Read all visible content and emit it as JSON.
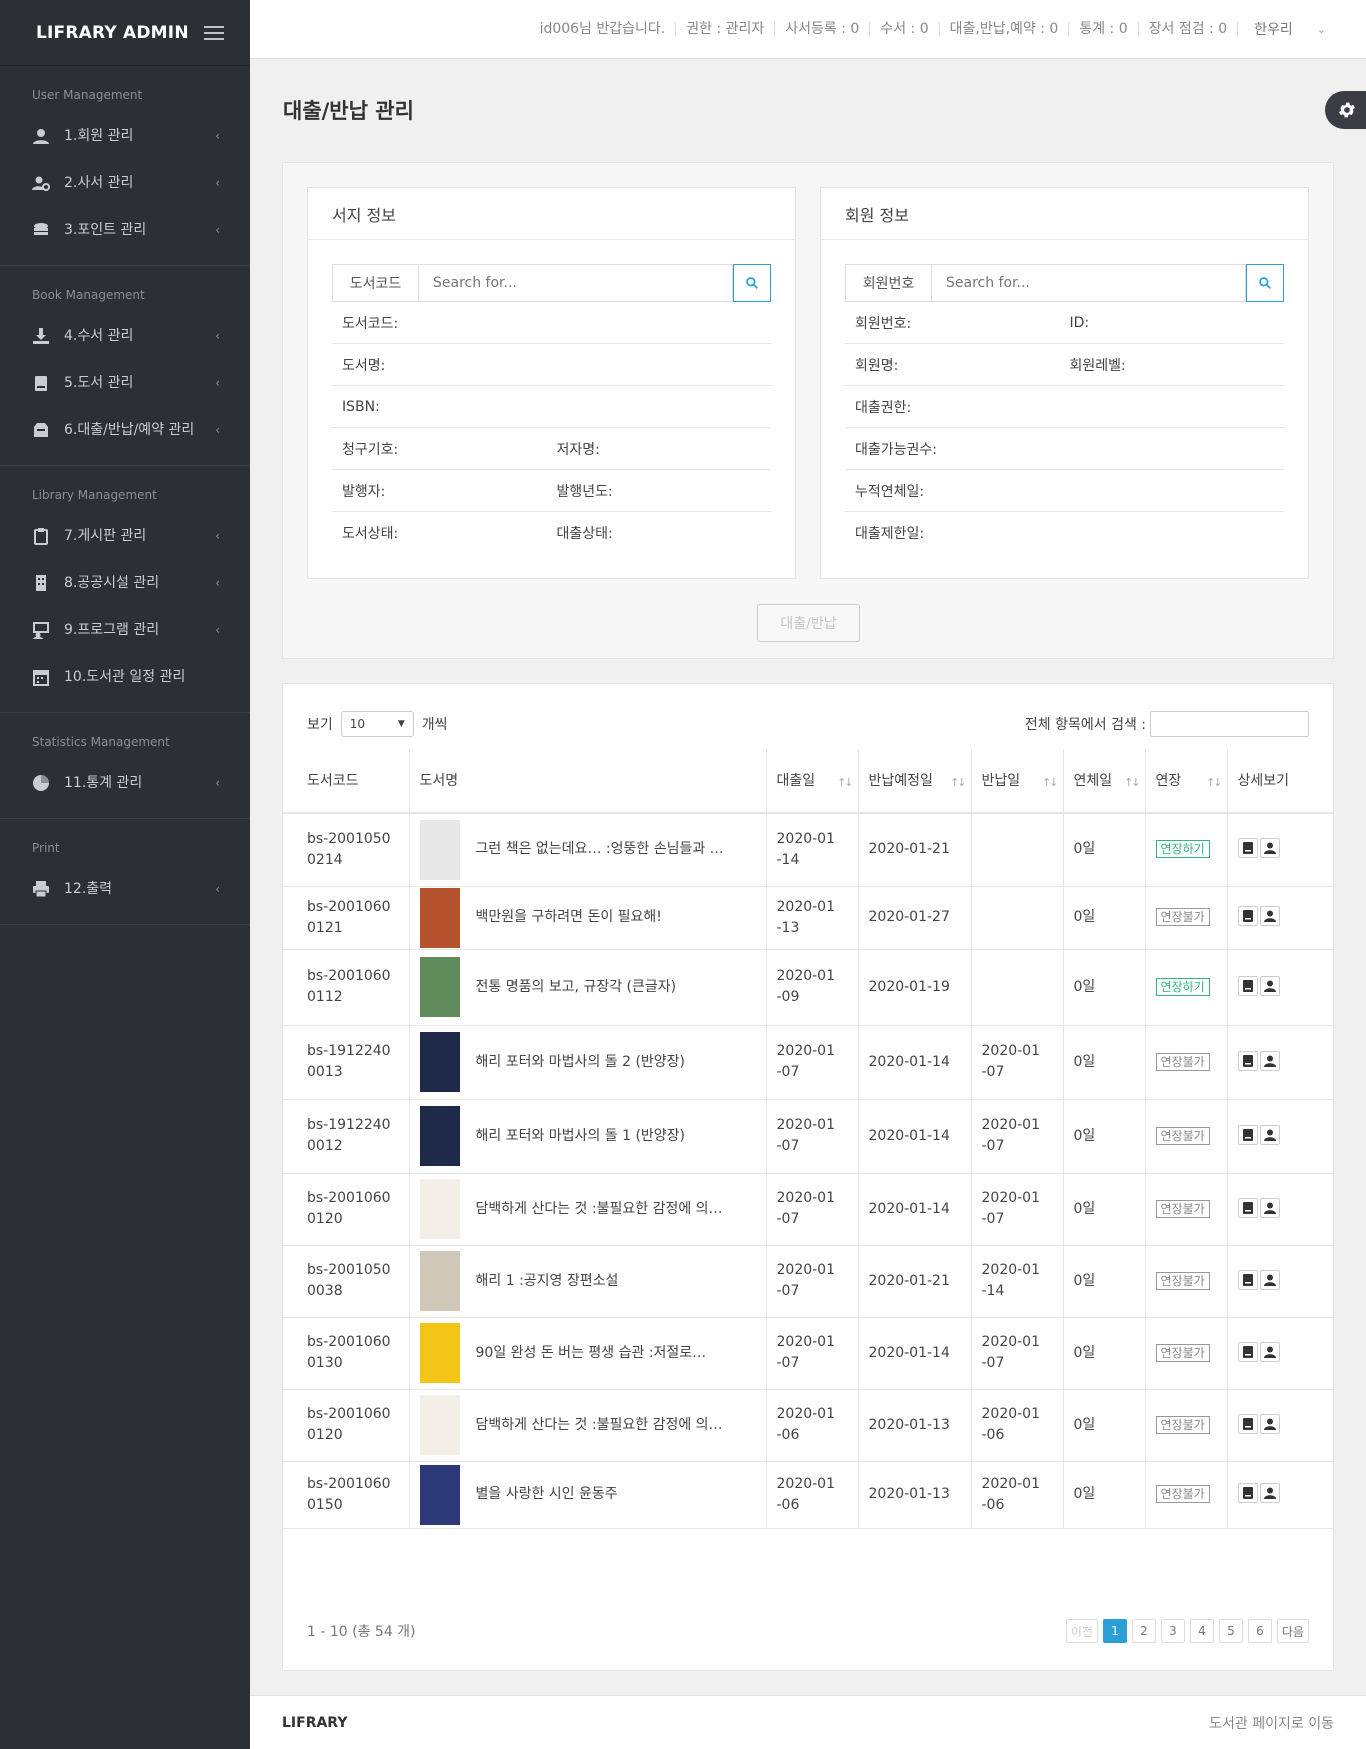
{
  "brand": {
    "title": "LIFRARY ADMIN"
  },
  "topbar": {
    "greeting": "id006님 반갑습니다.",
    "role": "권한 : 관리자",
    "items": [
      "사서등록 : 0",
      "수서 : 0",
      "대출,반납,예약 : 0",
      "통계 : 0",
      "장서 점검 : 0"
    ],
    "user": "한우리"
  },
  "sidebar": {
    "sections": [
      {
        "title": "User Management",
        "items": [
          "1.회원 관리",
          "2.사서 관리",
          "3.포인트 관리"
        ]
      },
      {
        "title": "Book Management",
        "items": [
          "4.수서 관리",
          "5.도서 관리",
          "6.대출/반납/예약 관리"
        ]
      },
      {
        "title": "Library Management",
        "items": [
          "7.게시판 관리",
          "8.공공시설 관리",
          "9.프로그램 관리",
          "10.도서관 일정 관리"
        ]
      },
      {
        "title": "Statistics Management",
        "items": [
          "11.통계 관리"
        ]
      },
      {
        "title": "Print",
        "items": [
          "12.출력"
        ]
      }
    ]
  },
  "page": {
    "title": "대출/반납 관리"
  },
  "book_card": {
    "title": "서지 정보",
    "search_label": "도서코드",
    "search_placeholder": "Search for...",
    "fields": {
      "code": "도서코드:",
      "name": "도서명:",
      "isbn": "ISBN:",
      "call_no": "청구기호:",
      "author": "저자명:",
      "publisher": "발행자:",
      "year": "발행년도:",
      "status": "도서상태:",
      "loan_status": "대출상태:"
    }
  },
  "member_card": {
    "title": "회원 정보",
    "search_label": "회원번호",
    "search_placeholder": "Search for...",
    "fields": {
      "no": "회원번호:",
      "id": "ID:",
      "name": "회원명:",
      "level": "회원레벨:",
      "right": "대출권한:",
      "avail": "대출가능권수:",
      "overdue": "누적연체일:",
      "limit": "대출제한일:"
    }
  },
  "lend_button": "대출/반납",
  "table": {
    "show_label": "보기",
    "page_size": "10",
    "unit_label": "개씩",
    "search_label": "전체 항목에서 검색 :",
    "headers": [
      "도서코드",
      "도서명",
      "대출일",
      "반납예정일",
      "반납일",
      "연체일",
      "연장",
      "상세보기"
    ],
    "rows": [
      {
        "code": "bs-20010500214",
        "title": "그런 책은 없는데요… :엉뚱한 손님들과 …",
        "loan": "2020-01-14",
        "due": "2020-01-21",
        "ret": "",
        "overdue": "0일",
        "ext": "연장하기",
        "ext_ok": true,
        "cover": "#e8e8e8"
      },
      {
        "code": "bs-20010600121",
        "title": "백만원을 구하려면 돈이 필요해!",
        "loan": "2020-01-13",
        "due": "2020-01-27",
        "ret": "",
        "overdue": "0일",
        "ext": "연장불가",
        "ext_ok": false,
        "cover": "#b5532e"
      },
      {
        "code": "bs-20010600112",
        "title": "전통 명품의 보고, 규장각 (큰글자)",
        "loan": "2020-01-09",
        "due": "2020-01-19",
        "ret": "",
        "overdue": "0일",
        "ext": "연장하기",
        "ext_ok": true,
        "cover": "#5f8a5a"
      },
      {
        "code": "bs-19122400013",
        "title": "해리 포터와 마법사의 돌 2 (반양장)",
        "loan": "2020-01-07",
        "due": "2020-01-14",
        "ret": "2020-01-07",
        "overdue": "0일",
        "ext": "연장불가",
        "ext_ok": false,
        "cover": "#1f2a4a"
      },
      {
        "code": "bs-19122400012",
        "title": "해리 포터와 마법사의 돌 1 (반양장)",
        "loan": "2020-01-07",
        "due": "2020-01-14",
        "ret": "2020-01-07",
        "overdue": "0일",
        "ext": "연장불가",
        "ext_ok": false,
        "cover": "#1f2a4a"
      },
      {
        "code": "bs-20010600120",
        "title": "담백하게 산다는 것 :불필요한 감정에 의…",
        "loan": "2020-01-07",
        "due": "2020-01-14",
        "ret": "2020-01-07",
        "overdue": "0일",
        "ext": "연장불가",
        "ext_ok": false,
        "cover": "#f3efe6"
      },
      {
        "code": "bs-20010500038",
        "title": "해리 1 :공지영 장편소설",
        "loan": "2020-01-07",
        "due": "2020-01-21",
        "ret": "2020-01-14",
        "overdue": "0일",
        "ext": "연장불가",
        "ext_ok": false,
        "cover": "#cfc7b8"
      },
      {
        "code": "bs-20010600130",
        "title": "90일 완성 돈 버는 평생 습관 :저절로…",
        "loan": "2020-01-07",
        "due": "2020-01-14",
        "ret": "2020-01-07",
        "overdue": "0일",
        "ext": "연장불가",
        "ext_ok": false,
        "cover": "#f2c416"
      },
      {
        "code": "bs-20010600120",
        "title": "담백하게 산다는 것 :불필요한 감정에 의…",
        "loan": "2020-01-06",
        "due": "2020-01-13",
        "ret": "2020-01-06",
        "overdue": "0일",
        "ext": "연장불가",
        "ext_ok": false,
        "cover": "#f3efe6"
      },
      {
        "code": "bs-20010600150",
        "title": "별을 사랑한 시인 윤동주",
        "loan": "2020-01-06",
        "due": "2020-01-13",
        "ret": "2020-01-06",
        "overdue": "0일",
        "ext": "연장불가",
        "ext_ok": false,
        "cover": "#2c3a7a"
      }
    ],
    "summary": "1 - 10 (총 54 개)",
    "pager": {
      "prev": "이전",
      "pages": [
        "1",
        "2",
        "3",
        "4",
        "5",
        "6"
      ],
      "next": "다음"
    }
  },
  "footer": {
    "brand": "LIFRARY",
    "link": "도서관 페이지로 이동"
  }
}
